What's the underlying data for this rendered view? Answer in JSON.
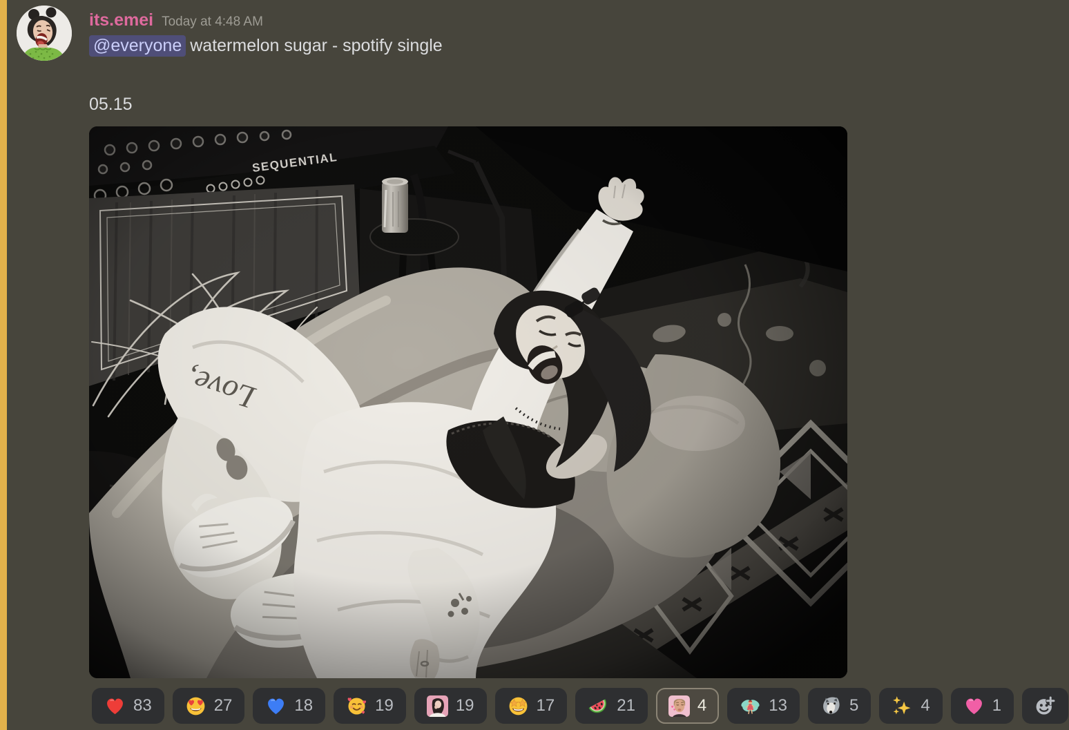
{
  "window": {
    "kind": "discord-chat-message-highlighted-mention"
  },
  "colors": {
    "page_background": "#47453c",
    "mention_bar": "#e2b14b",
    "username": "#df6a9e",
    "timestamp": "#9e9c94",
    "message_text": "#dcdddf",
    "mention_pill_bg": "#4f4e78",
    "mention_pill_text": "#cbcffa",
    "reaction_pill_bg": "#2e2f31",
    "reaction_count": "#b9bcc1",
    "reacted_pill_bg": "#4d4941",
    "reacted_pill_border": "#8b8475"
  },
  "message": {
    "username": "its.emei",
    "timestamp": "Today at 4:48 AM",
    "mention_label": "@everyone",
    "body_text": "watermelon sugar - spotify single",
    "caption": "05.15"
  },
  "photo": {
    "description": "Black-and-white photo: woman in a white sweatsuit sprawled on a velvet chaise with one arm thrown up, laughing; Sequential amp and pinstriped speaker cabinet behind her, soda can on a side table, patterned rugs on the floor",
    "amp_label": "SEQUENTIAL",
    "pants_text": "Love,"
  },
  "reactions": [
    {
      "emoji": "red-heart",
      "count": "83",
      "reacted": false
    },
    {
      "emoji": "heart-eyes-face",
      "count": "27",
      "reacted": false
    },
    {
      "emoji": "blue-heart",
      "count": "18",
      "reacted": false
    },
    {
      "emoji": "smiling-face-with-hearts",
      "count": "19",
      "reacted": false
    },
    {
      "emoji": "custom-emei-photo",
      "count": "19",
      "reacted": false
    },
    {
      "emoji": "star-struck-face",
      "count": "17",
      "reacted": false
    },
    {
      "emoji": "watermelon",
      "count": "21",
      "reacted": false
    },
    {
      "emoji": "custom-face-photo",
      "count": "4",
      "reacted": true
    },
    {
      "emoji": "fairy",
      "count": "13",
      "reacted": false
    },
    {
      "emoji": "wolf",
      "count": "5",
      "reacted": false
    },
    {
      "emoji": "sparkles",
      "count": "4",
      "reacted": false
    },
    {
      "emoji": "pink-heart",
      "count": "1",
      "reacted": false
    }
  ]
}
